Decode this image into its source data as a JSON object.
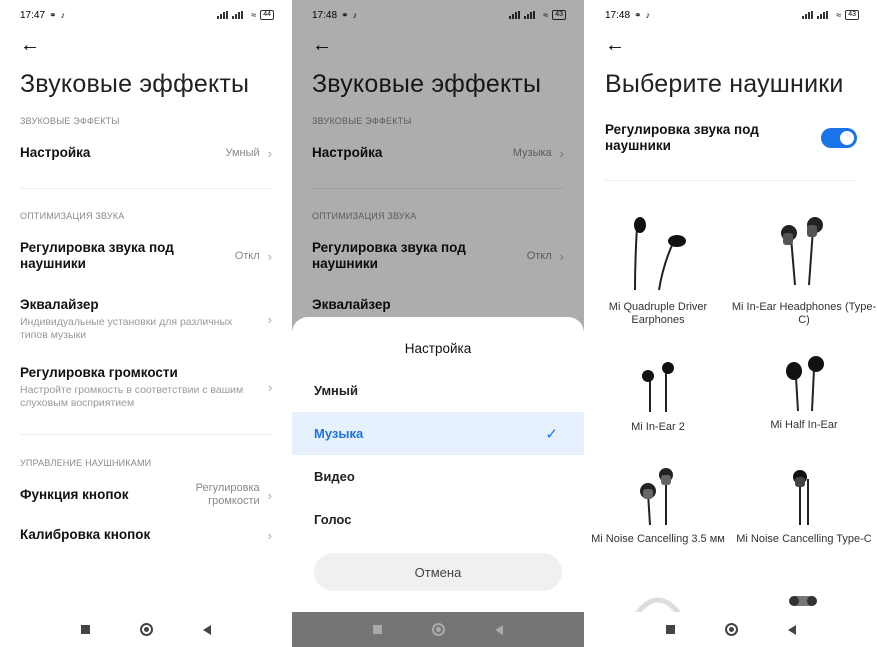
{
  "panel1": {
    "status": {
      "time": "17:47",
      "battery": "44"
    },
    "title": "Звуковые эффекты",
    "section1": "ЗВУКОВЫЕ ЭФФЕКТЫ",
    "setting": {
      "label": "Настройка",
      "value": "Умный"
    },
    "section2": "ОПТИМИЗАЦИЯ ЗВУКА",
    "headphone_adj": {
      "label": "Регулировка звука под наушники",
      "value": "Откл"
    },
    "equalizer": {
      "label": "Эквалайзер",
      "sub": "Индивидуальные установки для различных типов музыки"
    },
    "volume_adj": {
      "label": "Регулировка громкости",
      "sub": "Настройте громкость в соответствии с вашим слуховым восприятием"
    },
    "section3": "УПРАВЛЕНИЕ НАУШНИКАМИ",
    "button_func": {
      "label": "Функция кнопок",
      "value": "Регулировка громкости"
    },
    "button_calib": {
      "label": "Калибровка кнопок"
    }
  },
  "panel2": {
    "status": {
      "time": "17:48",
      "battery": "43"
    },
    "title": "Звуковые эффекты",
    "section1": "ЗВУКОВЫЕ ЭФФЕКТЫ",
    "setting": {
      "label": "Настройка",
      "value": "Музыка"
    },
    "section2": "ОПТИМИЗАЦИЯ ЗВУКА",
    "headphone_adj": {
      "label": "Регулировка звука под наушники",
      "value": "Откл"
    },
    "equalizer": {
      "label": "Эквалайзер"
    },
    "sheet": {
      "title": "Настройка",
      "options": [
        "Умный",
        "Музыка",
        "Видео",
        "Голос"
      ],
      "selected": "Музыка",
      "cancel": "Отмена"
    }
  },
  "panel3": {
    "status": {
      "time": "17:48",
      "battery": "43"
    },
    "title": "Выберите наушники",
    "toggle": {
      "label": "Регулировка звука под наушники",
      "on": true
    },
    "headphones": [
      "Mi Quadruple Driver Earphones",
      "Mi In-Ear Headphones (Type-C)",
      "Mi In-Ear 2",
      "Mi Half In-Ear",
      "Mi Noise Cancelling 3.5 мм",
      "Mi Noise Cancelling Type-C"
    ]
  },
  "colors": {
    "accent": "#1a73e8",
    "selected_bg": "#e7f1fd"
  }
}
